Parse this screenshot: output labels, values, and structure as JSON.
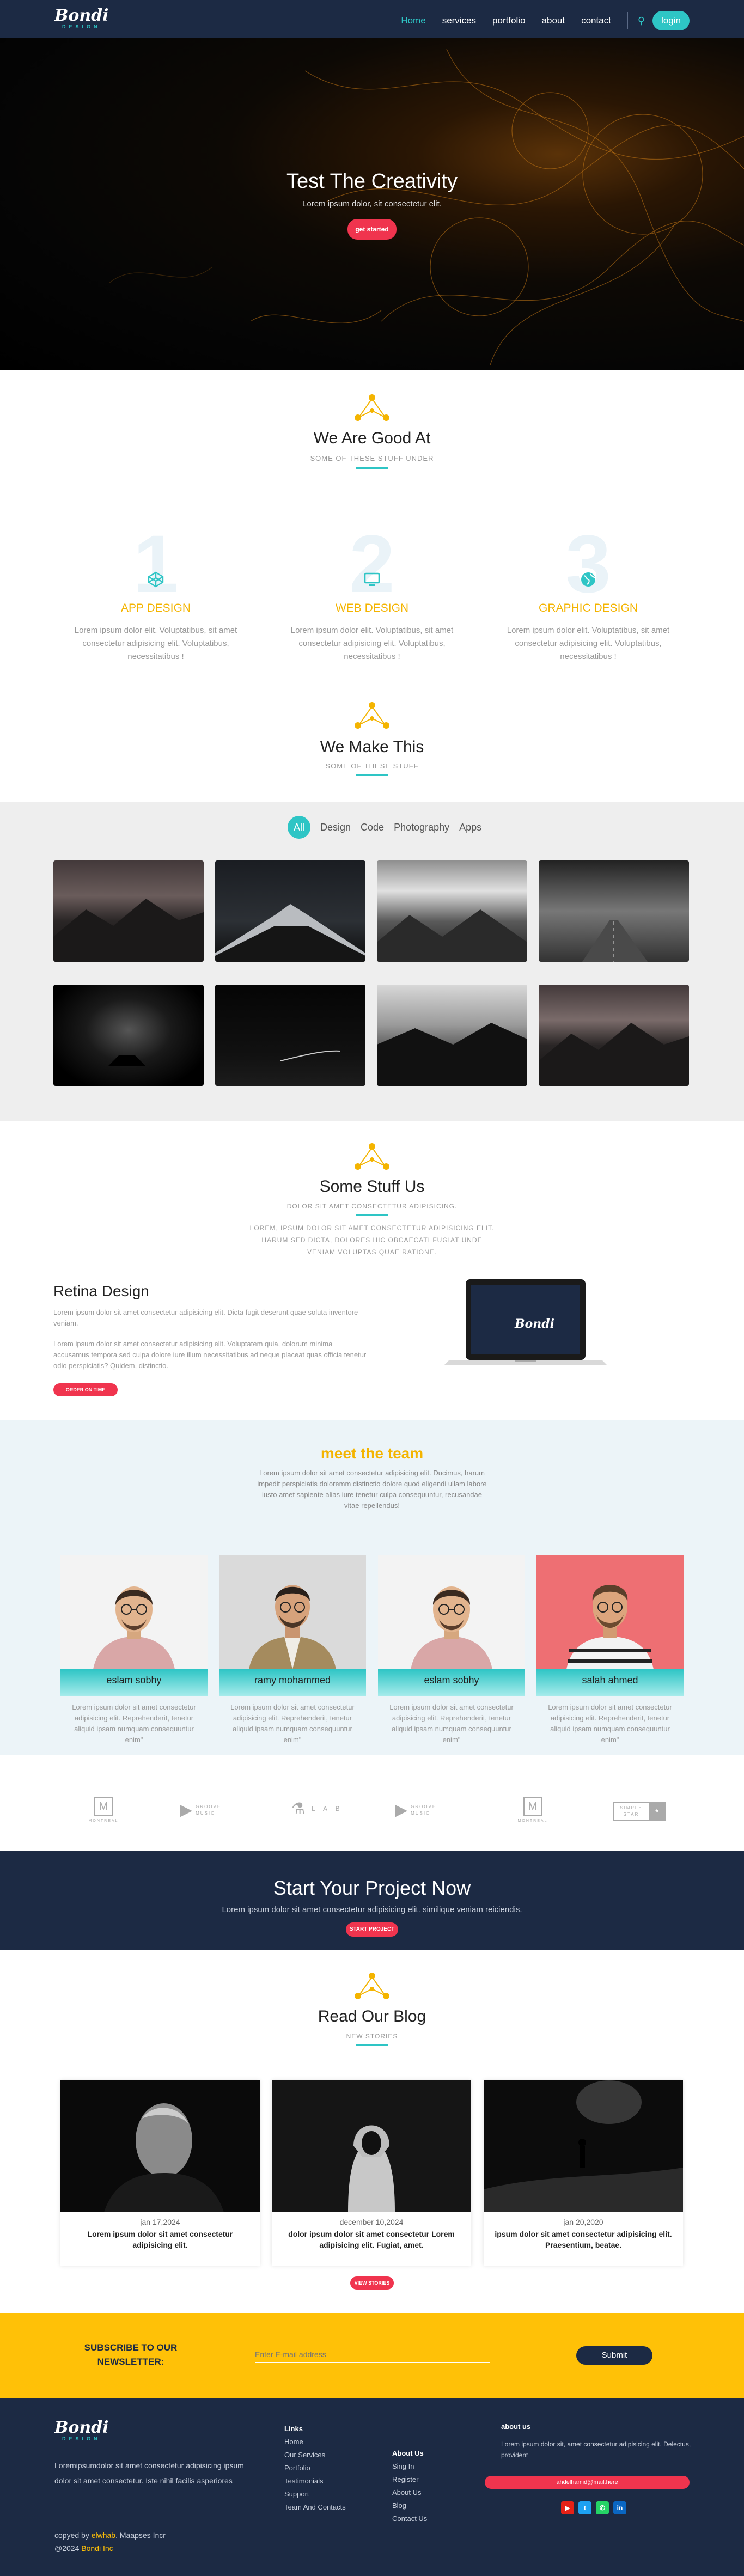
{
  "brand": {
    "name": "Bondi",
    "tagline": "DESIGN"
  },
  "nav": {
    "links": [
      "Home",
      "services",
      "portfolio",
      "about",
      "contact"
    ],
    "login": "login"
  },
  "hero": {
    "title": "Test The Creativity",
    "subtitle": "Lorem ipsum dolor, sit consectetur elit.",
    "button": "get started"
  },
  "good": {
    "title": "We Are Good At",
    "subtitle": "SOME OF THESE STUFF UNDER"
  },
  "features": [
    {
      "num": "1",
      "title": "APP DESIGN",
      "icon": "codepen-icon",
      "text": "Lorem ipsum dolor elit. Voluptatibus, sit amet consectetur adipisicing elit. Voluptatibus, necessitatibus !"
    },
    {
      "num": "2",
      "title": "WEB DESIGN",
      "icon": "monitor-icon",
      "text": "Lorem ipsum dolor elit. Voluptatibus, sit amet consectetur adipisicing elit. Voluptatibus, necessitatibus !"
    },
    {
      "num": "3",
      "title": "GRAPHIC DESIGN",
      "icon": "globe-icon",
      "text": "Lorem ipsum dolor elit. Voluptatibus, sit amet consectetur adipisicing elit. Voluptatibus, necessitatibus !"
    }
  ],
  "make": {
    "title": "We Make This",
    "subtitle": "SOME OF THESE STUFF"
  },
  "filters": [
    "All",
    "Design",
    "Code",
    "Photography",
    "Apps"
  ],
  "stuff": {
    "title": "Some Stuff Us",
    "subtitle": "DOLOR SIT AMET CONSECTETUR ADIPISICING.",
    "desc1": "LOREM, IPSUM DOLOR SIT AMET CONSECTETUR ADIPISICING ELIT.",
    "desc2": "HARUM SED DICTA, DOLORES HIC OBCAECATI FUGIAT UNDE",
    "desc3": "VENIAM VOLUPTAS QUAE RATIONE."
  },
  "retina": {
    "title": "Retina Design",
    "p1": "Lorem ipsum dolor sit amet consectetur adipisicing elit. Dicta fugit deserunt quae soluta inventore veniam.",
    "p2": "Lorem ipsum dolor sit amet consectetur adipisicing elit. Voluptatem quia, dolorum minima accusamus tempora sed culpa dolore iure illum necessitatibus ad neque placeat quas officia tenetur odio perspiciatis? Quidem, distinctio.",
    "button": "ORDER ON TIME"
  },
  "team": {
    "title": "meet the team",
    "desc": "Lorem ipsum dolor sit amet consectetur adipisicing elit. Ducimus, harum impedit perspiciatis doloremm distinctio dolore quod eligendi ullam labore iusto amet sapiente alias iure tenetur culpa consequuntur, recusandae vitae repellendus!",
    "members": [
      {
        "name": "eslam sobhy",
        "quote": "Lorem ipsum dolor sit amet consectetur adipisicing elit. Reprehenderit, tenetur aliquid ipsam numquam consequuntur enim\""
      },
      {
        "name": "ramy mohammed",
        "quote": "Lorem ipsum dolor sit amet consectetur adipisicing elit. Reprehenderit, tenetur aliquid ipsam numquam consequuntur enim\""
      },
      {
        "name": "eslam sobhy",
        "quote": "Lorem ipsum dolor sit amet consectetur adipisicing elit. Reprehenderit, tenetur aliquid ipsam numquam consequuntur enim\""
      },
      {
        "name": "salah ahmed",
        "quote": "Lorem ipsum dolor sit amet consectetur adipisicing elit. Reprehenderit, tenetur aliquid ipsam numquam consequuntur enim\""
      }
    ]
  },
  "brands": [
    "MONTREAL",
    "GROOVE MUSIC",
    "L A B",
    "GROOVE MUSIC",
    "MONTREAL",
    "SIMPLE STAR"
  ],
  "cta": {
    "title": "Start Your Project Now",
    "text": "Lorem ipsum dolor sit amet consectetur adipisicing elit. similique veniam reiciendis.",
    "button": "START PROJECT"
  },
  "blog": {
    "title": "Read Our Blog",
    "subtitle": "NEW STORIES",
    "button": "VIEW STORIES",
    "posts": [
      {
        "date": "jan 17,2024",
        "title": "Lorem ipsum dolor sit amet consectetur adipisicing elit."
      },
      {
        "date": "december 10,2024",
        "title": "dolor ipsum dolor sit amet consectetur Lorem adipisicing elit. Fugiat, amet."
      },
      {
        "date": "jan 20,2020",
        "title": "ipsum dolor sit amet consectetur adipisicing elit. Praesentium, beatae."
      }
    ]
  },
  "newsletter": {
    "title": "SUBSCRIBE TO OUR NEWSLETTER:",
    "placeholder": "Enter E-mail address",
    "button": "Submit"
  },
  "footer": {
    "about": "Loremipsumdolor sit amet consectetur adipisicing ipsum dolor sit amet consectetur. Iste nihil facilis asperiores",
    "copy1": "copyed by",
    "author": "elwhab",
    "copy2": ". Maapses Incr",
    "copy3": "@2024",
    "company": "Bondi Inc",
    "links_title": "Links",
    "links": [
      "Home",
      "Our Services",
      "Portfolio",
      "Testimonials",
      "Support",
      "Team And Contacts"
    ],
    "links2_title": "About Us",
    "links2": [
      "Sing In",
      "Register",
      "About Us",
      "Blog",
      "Contact Us"
    ],
    "about_title": "about us",
    "about_text": "Lorem ipsum dolor sit, amet consectetur adipisicing elit. Delectus, provident",
    "email": "ahdelhamid@mail.here"
  },
  "colors": {
    "navy": "#1c2a44",
    "teal": "#2ec5c5",
    "yellow": "#ffc107",
    "red": "#f0344e",
    "orange": "#f4b400"
  }
}
